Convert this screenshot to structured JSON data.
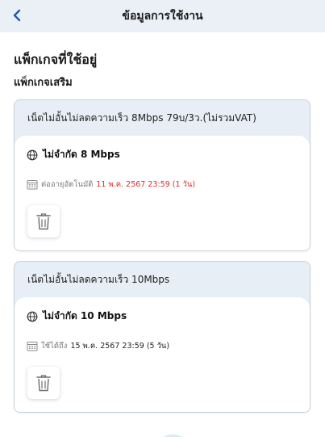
{
  "header": {
    "title": "ข้อมูลการใช้งาน",
    "back_icon": "chevron-left-icon",
    "accent": "#1a5fb4"
  },
  "section": {
    "title": "แพ็กเกจที่ใช้อยู่",
    "subtitle": "แพ็กเกจเสริม"
  },
  "packages": [
    {
      "name": "เน็ตไม่อั้นไม่ลดความเร็ว 8Mbps 79บ/3ว.(ไม่รวมVAT)",
      "speed": "ไม่จำกัด 8 Mbps",
      "date_prefix": "ต่ออายุอัตโนมัติ",
      "date_value": "11 พ.ค. 2567 23:59 (1 วัน)",
      "date_color": "#d92b2b",
      "delete_icon": "trash-icon"
    },
    {
      "name": "เน็ตไม่อั้นไม่ลดความเร็ว 10Mbps",
      "speed": "ไม่จำกัด 10 Mbps",
      "date_prefix": "ใช้ได้ถึง",
      "date_value": "15 พ.ค. 2567 23:59 (5 วัน)",
      "date_color": "#222222",
      "delete_icon": "trash-icon"
    }
  ]
}
